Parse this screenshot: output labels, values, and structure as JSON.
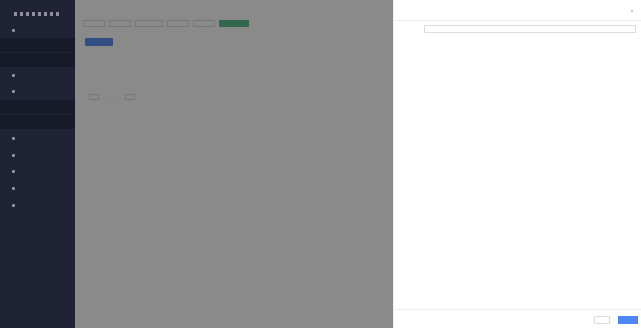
{
  "sidebar": {
    "logo_text": "",
    "items": [
      {
        "label": ""
      },
      {
        "label": ""
      },
      {
        "label": ""
      },
      {
        "label": ""
      },
      {
        "label": ""
      },
      {
        "label": ""
      },
      {
        "label": ""
      },
      {
        "label": ""
      },
      {
        "label": ""
      },
      {
        "label": ""
      },
      {
        "label": ""
      },
      {
        "label": ""
      }
    ]
  },
  "main": {
    "tabs": [
      {
        "label": ""
      },
      {
        "label": ""
      },
      {
        "label": ""
      },
      {
        "label": ""
      },
      {
        "label": ""
      },
      {
        "label": ""
      }
    ],
    "add_button_label": "",
    "table_headers": [
      "",
      "",
      ""
    ],
    "row_note": "",
    "pager": {
      "total_label": "",
      "page_label": "",
      "page_size_label": ""
    }
  },
  "drawer": {
    "title": "",
    "fields": [
      {
        "label": "",
        "placeholder": ""
      },
      {
        "label": "",
        "placeholder": ""
      }
    ],
    "cancel_label": "",
    "ok_label": ""
  },
  "colors": {
    "sidebar_bg": "#1f2333",
    "tab_active": "#5dbf8e",
    "primary": "#4f86f7"
  }
}
